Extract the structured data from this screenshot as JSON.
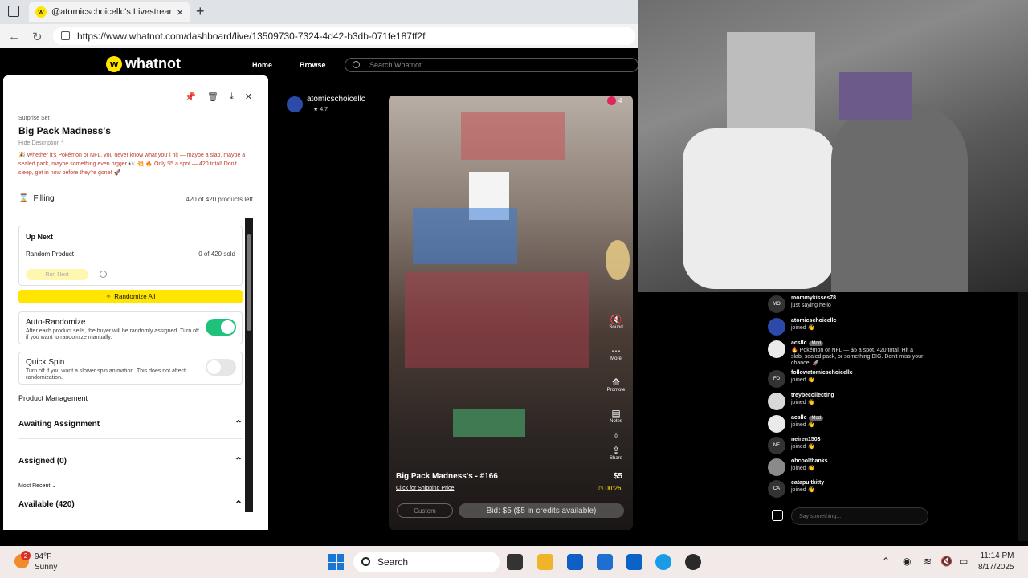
{
  "browser": {
    "tab_title": "@atomicschoicellc's Livestream o",
    "url": "https://www.whatnot.com/dashboard/live/13509730-7324-4d42-b3db-071fe187ff2f"
  },
  "whatnot": {
    "logo": "whatnot",
    "nav_home": "Home",
    "nav_browse": "Browse",
    "search_placeholder": "Search Whatnot"
  },
  "panel": {
    "subtitle": "Surprise Set",
    "title": "Big Pack Madness's",
    "hide_description": "Hide Description ^",
    "description": "🎉 Whether it's Pokémon or NFL, you never know what you'll hit — maybe a slab, maybe a sealed pack, maybe something even bigger 👀 💥 🔥 Only $5 a spot — 420 total! Don't sleep, get in now before they're gone! 🚀",
    "filling_label": "Filling",
    "products_left": "420 of 420 products left",
    "up_next": "Up Next",
    "random_product": "Random Product",
    "sold": "0 of 420 sold",
    "run_next": "Run Next",
    "randomize_all": "Randomize All",
    "auto_randomize_title": "Auto-Randomize",
    "auto_randomize_desc": "After each product sells, the buyer will be randomly assigned. Turn off if you want to randomize manually.",
    "auto_randomize_on": true,
    "quick_spin_title": "Quick Spin",
    "quick_spin_desc": "Turn off if you want a slower spin animation. This does not affect randomization.",
    "quick_spin_on": false,
    "product_management": "Product Management",
    "awaiting_assignment": "Awaiting Assignment",
    "assigned": "Assigned (0)",
    "most_recent": "Most Recent",
    "available": "Available (420)"
  },
  "stream": {
    "host_name": "atomicschoicellc",
    "host_rating": "4.7",
    "viewers": "4",
    "actions": [
      {
        "icon": "mute-icon",
        "label": "Sound"
      },
      {
        "icon": "more-icon",
        "label": "More"
      },
      {
        "icon": "promote-icon",
        "label": "Promote"
      },
      {
        "icon": "notes-icon",
        "label": "Notes"
      },
      {
        "icon": "share-icon",
        "label": "Share"
      }
    ],
    "share_count": "0",
    "product_title": "Big Pack Madness's - #166",
    "shipping_link": "Click for Shipping Price",
    "price": "$5",
    "timer": "00:26",
    "custom_button": "Custom",
    "bid_button": "Bid: $5 ($5 in credits available)"
  },
  "chat": {
    "messages": [
      {
        "initials": "MO",
        "user": "mommykisses78",
        "text": "just saying hello",
        "mod": false
      },
      {
        "initials": "",
        "user": "atomicschoicellc",
        "text": "joined 👋",
        "mod": false
      },
      {
        "initials": "",
        "user": "acsllc",
        "text": "🔥 Pokémon or NFL — $5 a spot, 420 total! Hit a slab, sealed pack, or something BIG. Don't miss your chance! 🚀",
        "mod": true
      },
      {
        "initials": "FO",
        "user": "followatomicschoicellc",
        "text": "joined 👋",
        "mod": false
      },
      {
        "initials": "",
        "user": "treybecollecting",
        "text": "joined 👋",
        "mod": false
      },
      {
        "initials": "",
        "user": "acsllc",
        "text": "joined 👋",
        "mod": true
      },
      {
        "initials": "NE",
        "user": "neiren1503",
        "text": "joined 👋",
        "mod": false
      },
      {
        "initials": "",
        "user": "ohcoolthanks",
        "text": "joined 👋",
        "mod": false
      },
      {
        "initials": "CA",
        "user": "catapultkitty",
        "text": "joined 👋",
        "mod": false
      }
    ],
    "mod_label": "Mod",
    "input_placeholder": "Say something..."
  },
  "taskbar": {
    "weather_badge": "2",
    "temperature": "94°F",
    "condition": "Sunny",
    "search": "Search",
    "time": "11:14 PM",
    "date": "8/17/2025"
  },
  "colors": {
    "brand_yellow": "#ffe500",
    "toggle_on": "#1ec27a",
    "live_red": "#e0245e"
  }
}
